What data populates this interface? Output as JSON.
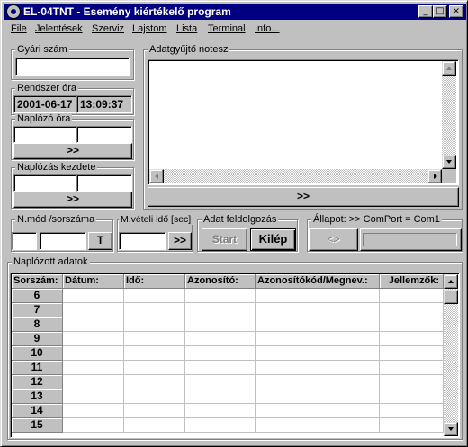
{
  "window": {
    "title": "EL-04TNT - Esemény kiértékelő program",
    "controls": {
      "minimize": "_",
      "maximize": "□",
      "close": "×"
    }
  },
  "menu": [
    "File",
    "Jelentések",
    "Szerviz",
    "Lajstom",
    "Lista",
    "Terminal",
    "Info..."
  ],
  "gyari_szam": {
    "label": "Gyári szám",
    "value": ""
  },
  "rendszer_ora": {
    "label": "Rendszer óra",
    "date": "2001-06-17",
    "time": "13:09:37"
  },
  "naplozo_ora": {
    "label": "Naplózó óra",
    "date": "",
    "time": "",
    "button": ">>"
  },
  "naplozas_kezdete": {
    "label": "Naplózás kezdete",
    "date": "",
    "time": "",
    "button": ">>"
  },
  "notesz": {
    "label": "Adatgyűjtő notesz",
    "content": "",
    "button": ">>"
  },
  "nmod": {
    "label": "N.mód /sorszáma",
    "mode": "",
    "number": "",
    "button": "T"
  },
  "mveteli": {
    "label": "M.vételi idő [sec]",
    "value": "",
    "button": ">>"
  },
  "feldolgozas": {
    "label": "Adat feldolgozás",
    "start": "Start",
    "exit": "Kilép"
  },
  "allapot": {
    "label": "Állapot: >> ComPort = Com1",
    "button": "<>",
    "progress": 0
  },
  "naplozott": {
    "label": "Naplózott adatok",
    "columns": [
      "Sorszám:",
      "Dátum:",
      "Idő:",
      "Azonosító:",
      "Azonosítókód/Megnev.:",
      "Jellemzők:"
    ],
    "rows": [
      "6",
      "7",
      "8",
      "9",
      "10",
      "11",
      "12",
      "13",
      "14",
      "15"
    ]
  }
}
